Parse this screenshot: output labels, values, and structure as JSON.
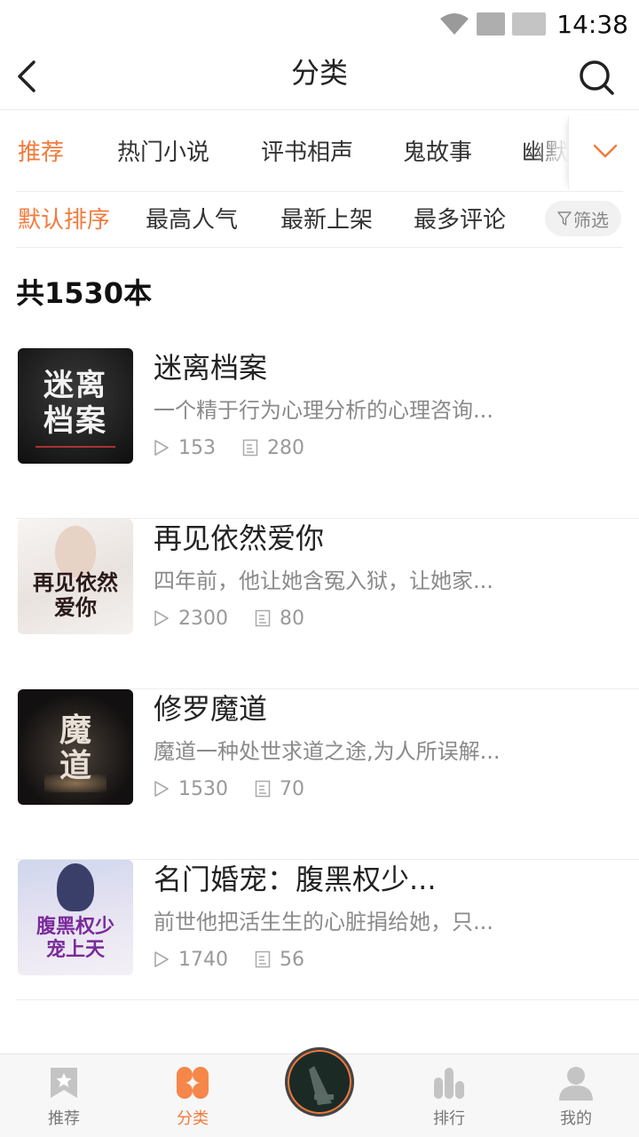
{
  "status_bar": {
    "time": "14:38"
  },
  "header": {
    "title": "分类"
  },
  "category_tabs": [
    "推荐",
    "热门小说",
    "评书相声",
    "鬼故事",
    "幽默"
  ],
  "sort_options": [
    "默认排序",
    "最高人气",
    "最新上架",
    "最多评论"
  ],
  "filter_label": "筛选",
  "total_count": "共1530本",
  "books": [
    {
      "title": "迷离档案",
      "desc": "一个精于行为心理分析的心理咨询...",
      "plays": "153",
      "chapters": "280",
      "cover_text": "迷离档案"
    },
    {
      "title": "再见依然爱你",
      "desc": "四年前，他让她含冤入狱，让她家...",
      "plays": "2300",
      "chapters": "80",
      "cover_text": "再见依然爱你"
    },
    {
      "title": "修罗魔道",
      "desc": "魔道一种处世求道之途,为人所误解...",
      "plays": "1530",
      "chapters": "70",
      "cover_text": "魔道"
    },
    {
      "title": "名门婚宠：腹黑权少...",
      "desc": "前世他把活生生的心脏捐给她，只...",
      "plays": "1740",
      "chapters": "56",
      "cover_text": "腹黑权少宠上天"
    }
  ],
  "bottom_nav": {
    "recommend": "推荐",
    "category": "分类",
    "ranking": "排行",
    "mine": "我的"
  },
  "colors": {
    "accent": "#f27a3c",
    "muted": "#999999",
    "divider": "#ededed"
  }
}
